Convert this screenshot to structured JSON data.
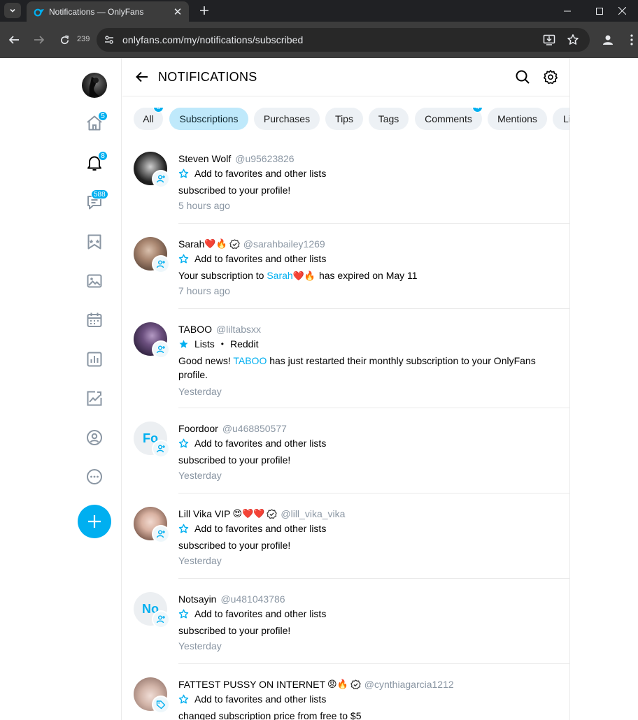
{
  "browser": {
    "tab_title": "Notifications — OnlyFans",
    "reload_count": "239",
    "url": "onlyfans.com/my/notifications/subscribed"
  },
  "sidebar": {
    "home_badge": "5",
    "notifications_badge": "8",
    "messages_badge": "588"
  },
  "header": {
    "title": "NOTIFICATIONS"
  },
  "filters": [
    {
      "label": "All",
      "badge": "8",
      "active": false
    },
    {
      "label": "Subscriptions",
      "badge": "",
      "active": true
    },
    {
      "label": "Purchases",
      "badge": "",
      "active": false
    },
    {
      "label": "Tips",
      "badge": "",
      "active": false
    },
    {
      "label": "Tags",
      "badge": "",
      "active": false
    },
    {
      "label": "Comments",
      "badge": "4",
      "active": false
    },
    {
      "label": "Mentions",
      "badge": "",
      "active": false
    },
    {
      "label": "Li",
      "badge": "",
      "active": false
    }
  ],
  "notifications": [
    {
      "name": "Steven Wolf",
      "handle": "@u95623826",
      "list_text": "Add to favorites and other lists",
      "message": "subscribed to your profile!",
      "time": "5 hours ago"
    },
    {
      "name": "Sarah",
      "name_emojis": "❤️🔥",
      "handle": "@sarahbailey1269",
      "list_text": "Add to favorites and other lists",
      "message_prefix": "Your subscription to ",
      "message_link": "Sarah",
      "message_link_emojis": "❤️🔥",
      "message_suffix": " has expired on May 11",
      "time": "7 hours ago"
    },
    {
      "name": "TABOO",
      "handle": "@liltabsxx",
      "list_text": "Lists",
      "list_extra": "Reddit",
      "message_prefix": "Good news! ",
      "message_link": "TABOO",
      "message_suffix": " has just restarted their monthly subscription to your OnlyFans profile.",
      "time": "Yesterday"
    },
    {
      "name": "Foordoor",
      "initials": "Fo",
      "handle": "@u468850577",
      "list_text": "Add to favorites and other lists",
      "message": "subscribed to your profile!",
      "time": "Yesterday"
    },
    {
      "name": "Lill Vika VIP",
      "name_emojis": "😍❤️❤️",
      "handle": "@lill_vika_vika",
      "list_text": "Add to favorites and other lists",
      "message": "subscribed to your profile!",
      "time": "Yesterday"
    },
    {
      "name": "Notsayin",
      "initials": "No",
      "handle": "@u481043786",
      "list_text": "Add to favorites and other lists",
      "message": "subscribed to your profile!",
      "time": "Yesterday"
    },
    {
      "name": "FATTEST PUSSY ON INTERNET",
      "name_emojis": "😡🔥",
      "handle": "@cynthiagarcia1212",
      "list_text": "Add to favorites and other lists",
      "message": "changed subscription price from free to $5",
      "time": ""
    }
  ],
  "colors": {
    "accent": "#00aff0",
    "muted": "#8a96a3",
    "chip_bg": "#edf1f5",
    "chip_active_bg": "#bfe9fb"
  }
}
